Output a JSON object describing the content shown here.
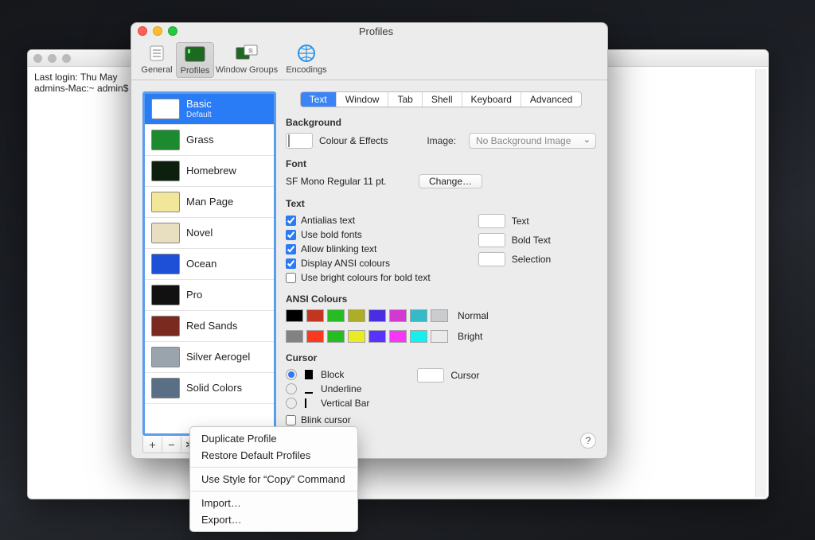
{
  "terminal": {
    "line1": "Last login: Thu May",
    "line2": "admins-Mac:~ admin$"
  },
  "window": {
    "title": "Profiles"
  },
  "toolbar": {
    "general": "General",
    "profiles": "Profiles",
    "window_groups": "Window Groups",
    "encodings": "Encodings"
  },
  "sidebar": {
    "profiles": [
      {
        "name": "Basic",
        "sub": "Default",
        "bg": "#ffffff"
      },
      {
        "name": "Grass",
        "bg": "#1e8a2f"
      },
      {
        "name": "Homebrew",
        "bg": "#0d1f0d"
      },
      {
        "name": "Man Page",
        "bg": "#f2e69a"
      },
      {
        "name": "Novel",
        "bg": "#e8dfc0"
      },
      {
        "name": "Ocean",
        "bg": "#1d4fd7"
      },
      {
        "name": "Pro",
        "bg": "#111111"
      },
      {
        "name": "Red Sands",
        "bg": "#7a2a1f"
      },
      {
        "name": "Silver Aerogel",
        "bg": "#9aa4ad"
      },
      {
        "name": "Solid Colors",
        "bg": "#5a6e86"
      }
    ],
    "default_btn": "Default"
  },
  "tabs": {
    "text": "Text",
    "window": "Window",
    "tab": "Tab",
    "shell": "Shell",
    "keyboard": "Keyboard",
    "advanced": "Advanced"
  },
  "background": {
    "heading": "Background",
    "colour_effects": "Colour & Effects",
    "image_label": "Image:",
    "image_value": "No Background Image"
  },
  "font": {
    "heading": "Font",
    "value": "SF Mono Regular 11 pt.",
    "change": "Change…"
  },
  "text": {
    "heading": "Text",
    "antialias": "Antialias text",
    "bold_fonts": "Use bold fonts",
    "blinking": "Allow blinking text",
    "ansi": "Display ANSI colours",
    "bright_bold": "Use bright colours for bold text",
    "text_label": "Text",
    "bold_text_label": "Bold Text",
    "selection_label": "Selection"
  },
  "ansi": {
    "heading": "ANSI Colours",
    "normal": "Normal",
    "bright": "Bright",
    "normal_colors": [
      "#000000",
      "#c23621",
      "#25bc24",
      "#adad27",
      "#492ee1",
      "#d338d3",
      "#33bbc8",
      "#cbcccd"
    ],
    "bright_colors": [
      "#818383",
      "#fc391f",
      "#25bc24",
      "#eaec23",
      "#5833ff",
      "#f935f8",
      "#14f0f0",
      "#e9ebeb"
    ]
  },
  "cursor": {
    "heading": "Cursor",
    "block": "Block",
    "underline": "Underline",
    "vertical": "Vertical Bar",
    "blink": "Blink cursor",
    "cursor_label": "Cursor"
  },
  "menu": {
    "duplicate": "Duplicate Profile",
    "restore": "Restore Default Profiles",
    "use_style": "Use Style for “Copy” Command",
    "import": "Import…",
    "export": "Export…"
  }
}
